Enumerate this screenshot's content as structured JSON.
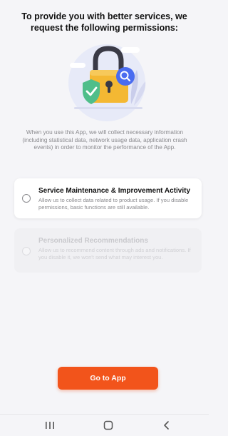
{
  "header": {
    "title": "To provide you with better services, we request the following permissions:"
  },
  "illustration": {
    "icon": "padlock-shield-search-illustration"
  },
  "intro": {
    "text": "When you use this App, we will collect necessary information (including statistical data, network usage data, application crash events) in order to monitor the performance of the App."
  },
  "permissions": [
    {
      "title": "Service Maintenance & Improvement Activity",
      "description": "Allow us to collect data related to product usage. If you disable permissions, basic functions are still available.",
      "selected": false,
      "enabled": true
    },
    {
      "title": "Personalized Recommendations",
      "description": "Allow us to recommend content through ads and notifications. If you disable it, we won't send what may interest you.",
      "selected": false,
      "enabled": false
    }
  ],
  "actions": {
    "go_label": "Go to App"
  },
  "nav_bar": {
    "recents_icon": "recents-icon",
    "home_icon": "home-icon",
    "back_icon": "back-icon"
  },
  "colors": {
    "accent": "#f2541b",
    "background": "#f5f5f8",
    "shield": "#4fbe8a",
    "lock": "#f4b833",
    "search_badge": "#4a6cf0"
  }
}
